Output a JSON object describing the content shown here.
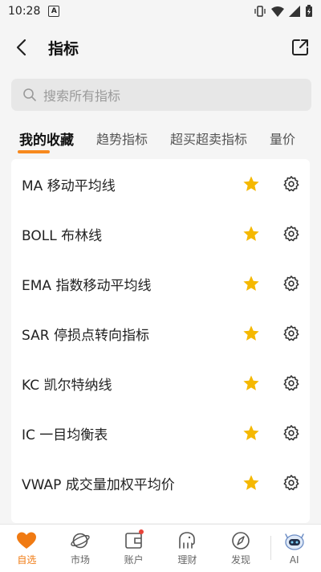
{
  "status_bar": {
    "time": "10:28",
    "notif_icon": "A"
  },
  "header": {
    "title": "指标"
  },
  "search": {
    "placeholder": "搜索所有指标"
  },
  "tabs": [
    {
      "label": "我的收藏",
      "active": true
    },
    {
      "label": "趋势指标"
    },
    {
      "label": "超买超卖指标"
    },
    {
      "label": "量价"
    }
  ],
  "indicators": [
    {
      "label": "MA 移动平均线"
    },
    {
      "label": "BOLL 布林线"
    },
    {
      "label": "EMA 指数移动平均线"
    },
    {
      "label": "SAR 停损点转向指标"
    },
    {
      "label": "KC 凯尔特纳线"
    },
    {
      "label": "IC 一目均衡表"
    },
    {
      "label": "VWAP 成交量加权平均价"
    }
  ],
  "tabbar": [
    {
      "label": "自选",
      "icon": "heart-icon",
      "active": true
    },
    {
      "label": "市场",
      "icon": "planet-icon"
    },
    {
      "label": "账户",
      "icon": "wallet-icon",
      "badge": true
    },
    {
      "label": "理财",
      "icon": "elephant-icon"
    },
    {
      "label": "发现",
      "icon": "compass-icon"
    },
    {
      "label": "AI",
      "icon": "robot-icon"
    }
  ],
  "colors": {
    "accent": "#f7891e",
    "star": "#f5b800",
    "active_tab_text": "#f07a12"
  }
}
